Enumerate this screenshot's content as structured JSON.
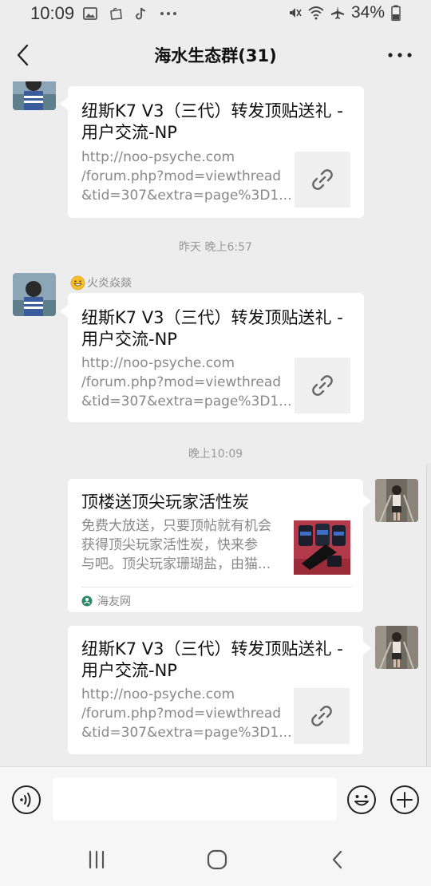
{
  "status": {
    "time": "10:09",
    "battery": "34%"
  },
  "header": {
    "title": "海水生态群(31)"
  },
  "chat": {
    "messages": [
      {
        "card_title": "纽斯K7 V3（三代）转发顶贴送礼 - 用户交流-NP",
        "desc_lines": [
          "http://noo-psyche.com",
          "/forum.php?mod=viewthread",
          "&tid=307&extra=page%3D1..."
        ]
      },
      {
        "timestamp": "昨天 晚上6:57",
        "sender": "火炎焱燚",
        "card_title": "纽斯K7 V3（三代）转发顶贴送礼 - 用户交流-NP",
        "desc_lines": [
          "http://noo-psyche.com",
          "/forum.php?mod=viewthread",
          "&tid=307&extra=page%3D1..."
        ]
      },
      {
        "timestamp": "晚上10:09",
        "card_title": "顶楼送顶尖玩家活性炭",
        "desc_lines": [
          "免费大放送，只要顶帖就有机会",
          "获得顶尖玩家活性炭，快来参",
          "与吧。顶尖玩家珊瑚盐，由猫..."
        ],
        "source": "海友网"
      },
      {
        "card_title": "纽斯K7 V3（三代）转发顶贴送礼 - 用户交流-NP",
        "desc_lines": [
          "http://noo-psyche.com",
          "/forum.php?mod=viewthread",
          "&tid=307&extra=page%3D1..."
        ]
      }
    ]
  },
  "input": {
    "placeholder": ""
  },
  "icons": {
    "status_left": [
      "gallery-icon",
      "bag-icon",
      "tiktok-icon",
      "more-dots-icon"
    ],
    "status_right": [
      "mute-icon",
      "wifi-icon",
      "airplane-icon",
      "battery-icon"
    ],
    "back": "back-chevron-icon",
    "more": "more-icon",
    "link": "link-icon",
    "voice": "voice-icon",
    "emoji": "emoji-icon",
    "plus": "plus-icon"
  },
  "colors": {
    "background": "#ededed",
    "card": "#ffffff",
    "muted_text": "#888888",
    "source_green": "#2a8a6a"
  }
}
